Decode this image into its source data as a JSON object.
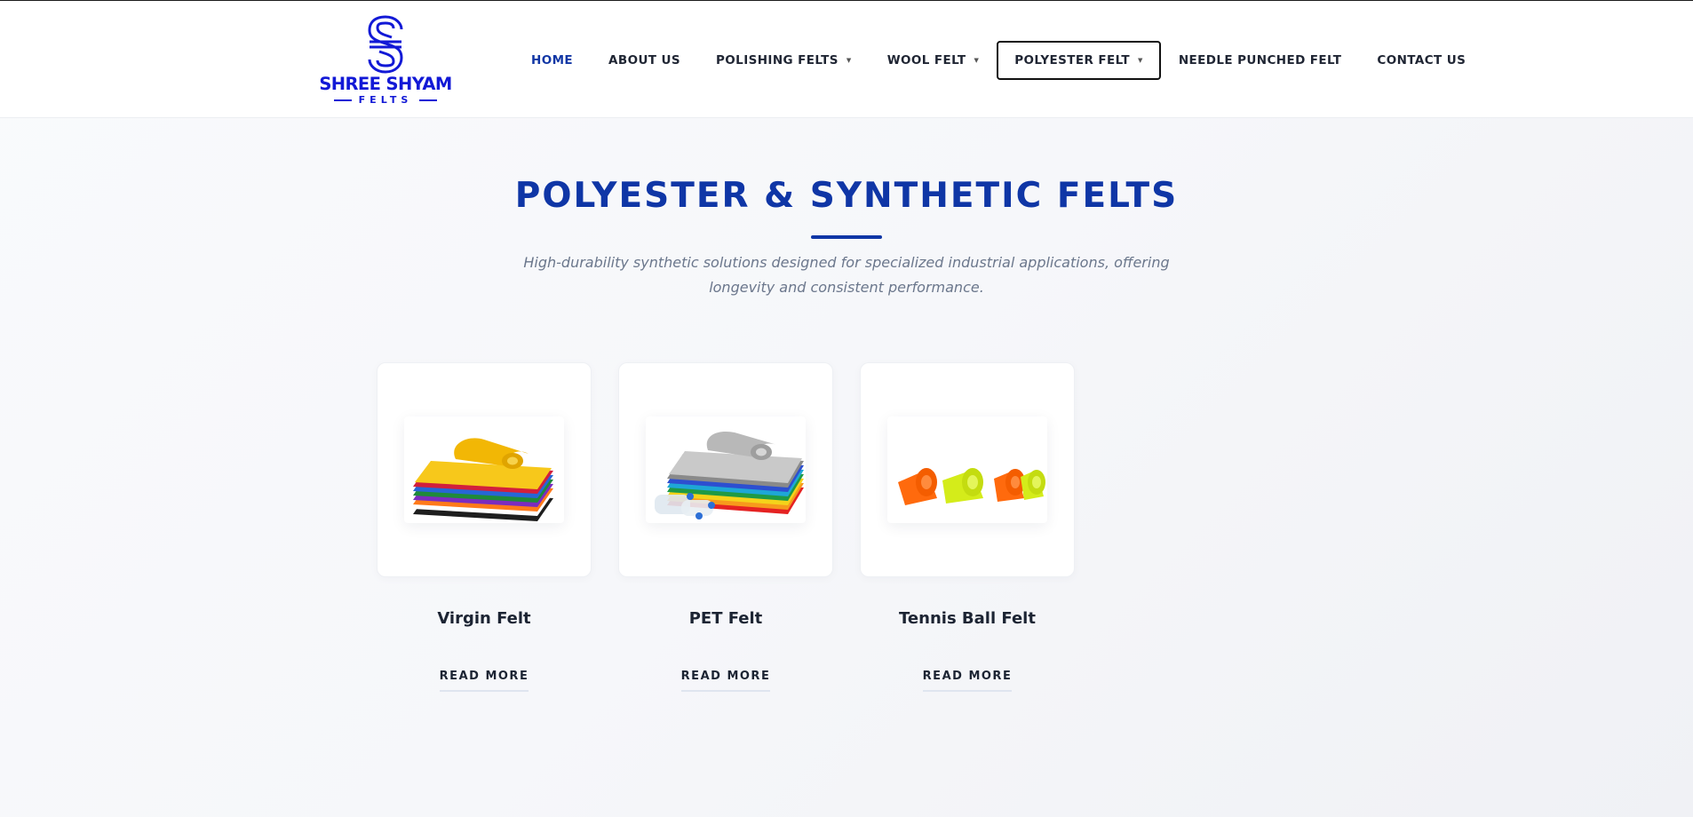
{
  "brand": {
    "name": "SHREE SHYAM",
    "sub": "FELTS",
    "color": "#1219d6"
  },
  "nav": [
    {
      "label": "HOME",
      "active": true,
      "dropdown": false
    },
    {
      "label": "ABOUT US",
      "active": false,
      "dropdown": false
    },
    {
      "label": "POLISHING FELTS",
      "active": false,
      "dropdown": true
    },
    {
      "label": "WOOL FELT",
      "active": false,
      "dropdown": true
    },
    {
      "label": "POLYESTER FELT",
      "active": false,
      "dropdown": true,
      "focused": true
    },
    {
      "label": "NEEDLE PUNCHED FELT",
      "active": false,
      "dropdown": false
    },
    {
      "label": "CONTACT US",
      "active": false,
      "dropdown": false
    }
  ],
  "caret": "▼",
  "section": {
    "title": "POLYESTER & SYNTHETIC FELTS",
    "description": "High-durability synthetic solutions designed for specialized industrial applications, offering longevity and consistent performance."
  },
  "products": [
    {
      "name": "Virgin Felt",
      "cta": "READ MORE",
      "image": "stacked-colorful-felt-sheets"
    },
    {
      "name": "PET Felt",
      "cta": "READ MORE",
      "image": "felt-sheets-with-plastic-bottles"
    },
    {
      "name": "Tennis Ball Felt",
      "cta": "READ MORE",
      "image": "orange-yellow-felt-rolls"
    }
  ],
  "colors": {
    "accent": "#0f36a6",
    "text": "#1c2433",
    "muted": "#6b778c"
  }
}
